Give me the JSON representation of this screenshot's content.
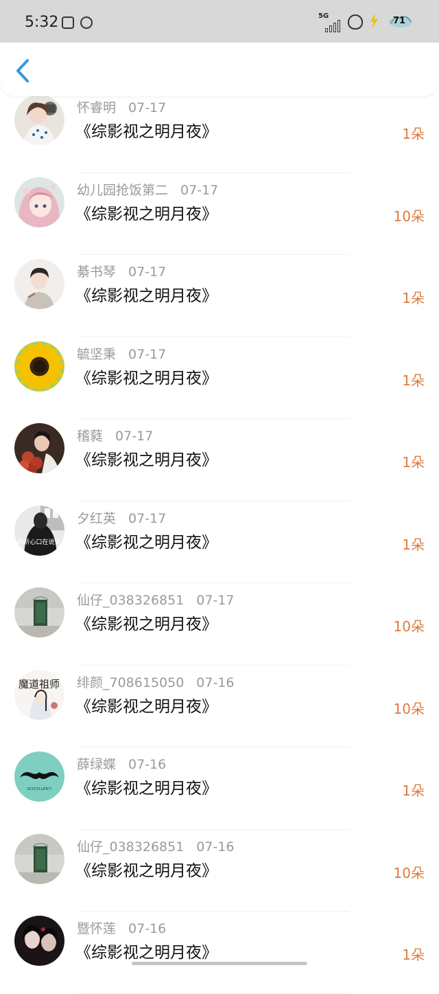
{
  "status_bar": {
    "time": "5:32",
    "network": "5G",
    "battery_level": "71"
  },
  "theme": {
    "accent": "#2f9be0",
    "amount_color": "#e07a3a",
    "meta_color": "#9a9a9a",
    "title_color": "#111111"
  },
  "items": [
    {
      "name": "怀睿明",
      "date": "07-17",
      "title": "《综影视之明月夜》",
      "amount": "1朵",
      "avatar": "girl-photo"
    },
    {
      "name": "幼儿园抢饭第二",
      "date": "07-17",
      "title": "《综影视之明月夜》",
      "amount": "10朵",
      "avatar": "anime-girl-pink"
    },
    {
      "name": "綦书琴",
      "date": "07-17",
      "title": "《综影视之明月夜》",
      "amount": "1朵",
      "avatar": "boy-portrait"
    },
    {
      "name": "毓坚秉",
      "date": "07-17",
      "title": "《综影视之明月夜》",
      "amount": "1朵",
      "avatar": "sunflower"
    },
    {
      "name": "稽蕤",
      "date": "07-17",
      "title": "《综影视之明月夜》",
      "amount": "1朵",
      "avatar": "man-with-roses"
    },
    {
      "name": "夕红英",
      "date": "07-17",
      "title": "《综影视之明月夜》",
      "amount": "1朵",
      "avatar": "monochrome-text",
      "avatar_text": "你听心口在说谎"
    },
    {
      "name": "仙仔_038326851",
      "date": "07-17",
      "title": "《综影视之明月夜》",
      "amount": "10朵",
      "avatar": "green-door"
    },
    {
      "name": "绯颜_708615050",
      "date": "07-16",
      "title": "《综影视之明月夜》",
      "amount": "10朵",
      "avatar": "calligraphy-anime",
      "avatar_text": "魔道祖师"
    },
    {
      "name": "薛绿蝶",
      "date": "07-16",
      "title": "《综影视之明月夜》",
      "amount": "1朵",
      "avatar": "mustache-teal",
      "avatar_text": "SEXCELLENT!"
    },
    {
      "name": "仙仔_038326851",
      "date": "07-16",
      "title": "《综影视之明月夜》",
      "amount": "10朵",
      "avatar": "green-door"
    },
    {
      "name": "暨怀莲",
      "date": "07-16",
      "title": "《综影视之明月夜》",
      "amount": "1朵",
      "avatar": "dark-couple"
    }
  ]
}
